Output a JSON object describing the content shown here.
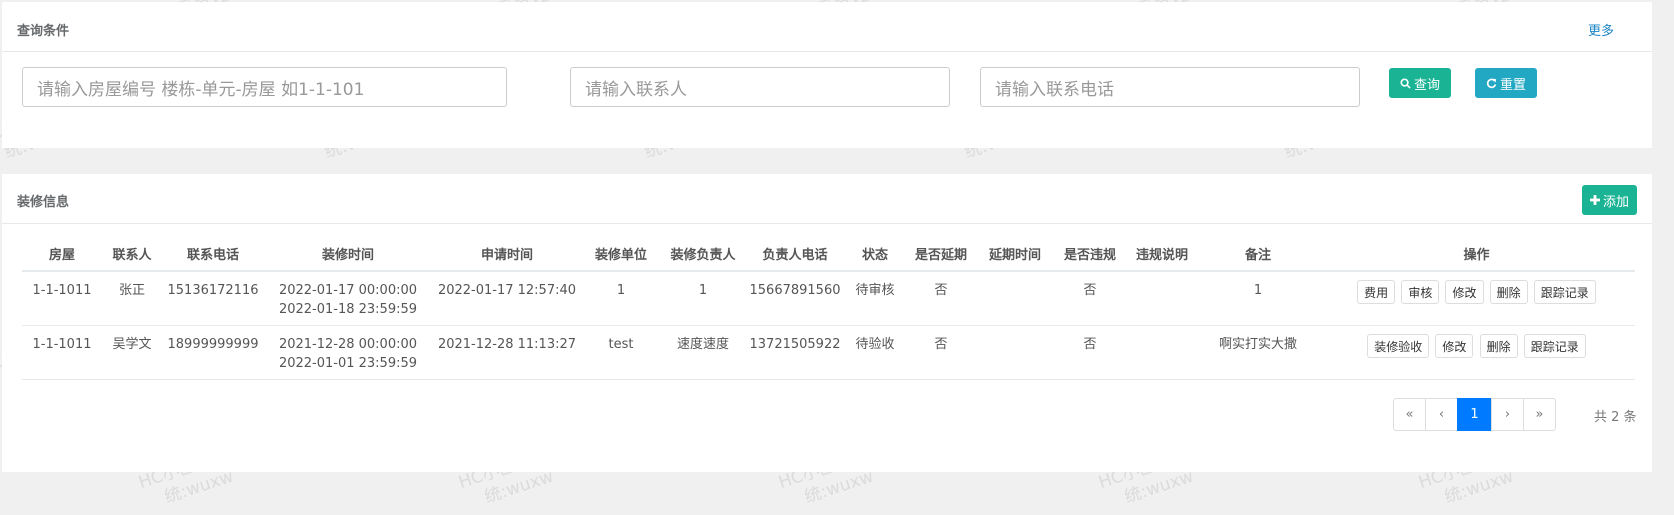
{
  "query_panel": {
    "title": "查询条件",
    "more_label": "更多",
    "room_placeholder": "请输入房屋编号 楼栋-单元-房屋 如1-1-101",
    "contact_placeholder": "请输入联系人",
    "phone_placeholder": "请输入联系电话",
    "search_label": "查询",
    "reset_label": "重置"
  },
  "list_panel": {
    "title": "装修信息",
    "add_label": "添加",
    "headers": [
      "房屋",
      "联系人",
      "联系电话",
      "装修时间",
      "申请时间",
      "装修单位",
      "装修负责人",
      "负责人电话",
      "状态",
      "是否延期",
      "延期时间",
      "是否违规",
      "违规说明",
      "备注",
      "操作"
    ],
    "rows": [
      {
        "room": "1-1-1011",
        "contact": "张正",
        "phone": "15136172116",
        "time_start": "2022-01-17 00:00:00",
        "time_end": "2022-01-18 23:59:59",
        "apply_time": "2022-01-17 12:57:40",
        "company": "1",
        "manager": "1",
        "manager_phone": "15667891560",
        "status": "待审核",
        "extended": "否",
        "extend_time": "",
        "violation": "否",
        "violation_desc": "",
        "remark": "1",
        "actions": [
          "费用",
          "审核",
          "修改",
          "删除",
          "跟踪记录"
        ]
      },
      {
        "room": "1-1-1011",
        "contact": "吴学文",
        "phone": "18999999999",
        "time_start": "2021-12-28 00:00:00",
        "time_end": "2022-01-01 23:59:59",
        "apply_time": "2021-12-28 11:13:27",
        "company": "test",
        "manager": "速度速度",
        "manager_phone": "13721505922",
        "status": "待验收",
        "extended": "否",
        "extend_time": "",
        "violation": "否",
        "violation_desc": "",
        "remark": "啊实打实大撒",
        "actions": [
          "装修验收",
          "修改",
          "删除",
          "跟踪记录"
        ]
      }
    ]
  },
  "pagination": {
    "first": "«",
    "prev": "‹",
    "current": "1",
    "next": "›",
    "last": "»",
    "total": "共 2 条"
  },
  "watermark": {
    "line1": "HC小区管理系",
    "line2": "统:wuxw"
  },
  "colors": {
    "primary": "#1ab394",
    "info": "#23a8c4",
    "link": "#1c84c6",
    "page_active": "#007bff"
  }
}
